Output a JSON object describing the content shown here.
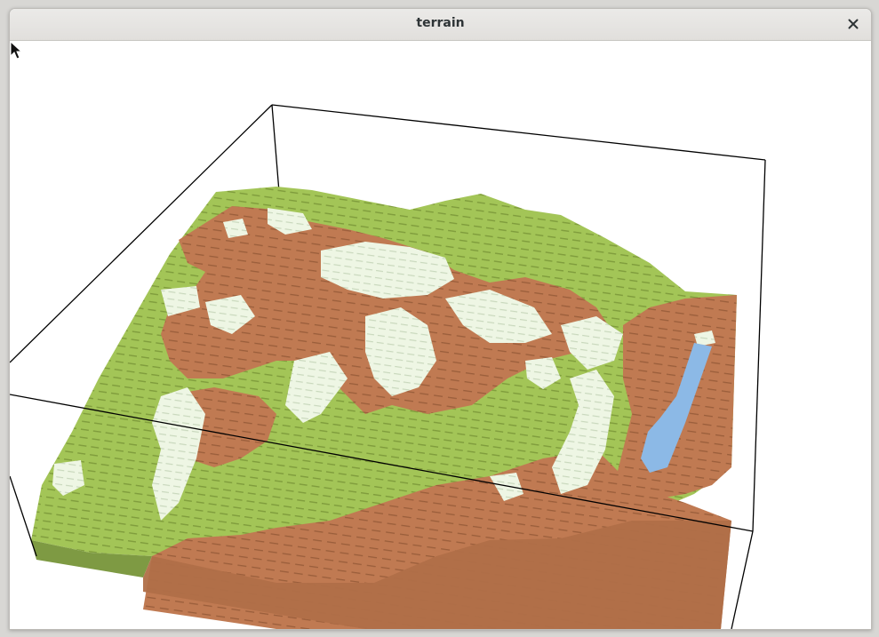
{
  "window": {
    "title": "terrain",
    "close_icon": "close-icon"
  },
  "scene": {
    "description_kind": "3d-voxel-terrain",
    "colors": {
      "grass": "#a3c557",
      "grass_dark": "#8fb24a",
      "dirt": "#c07a52",
      "dirt_dark": "#a8673f",
      "snow": "#eef6e4",
      "water": "#8cb9e6",
      "side_grass": "#7e9a43",
      "bounding_box": "#000000"
    }
  }
}
